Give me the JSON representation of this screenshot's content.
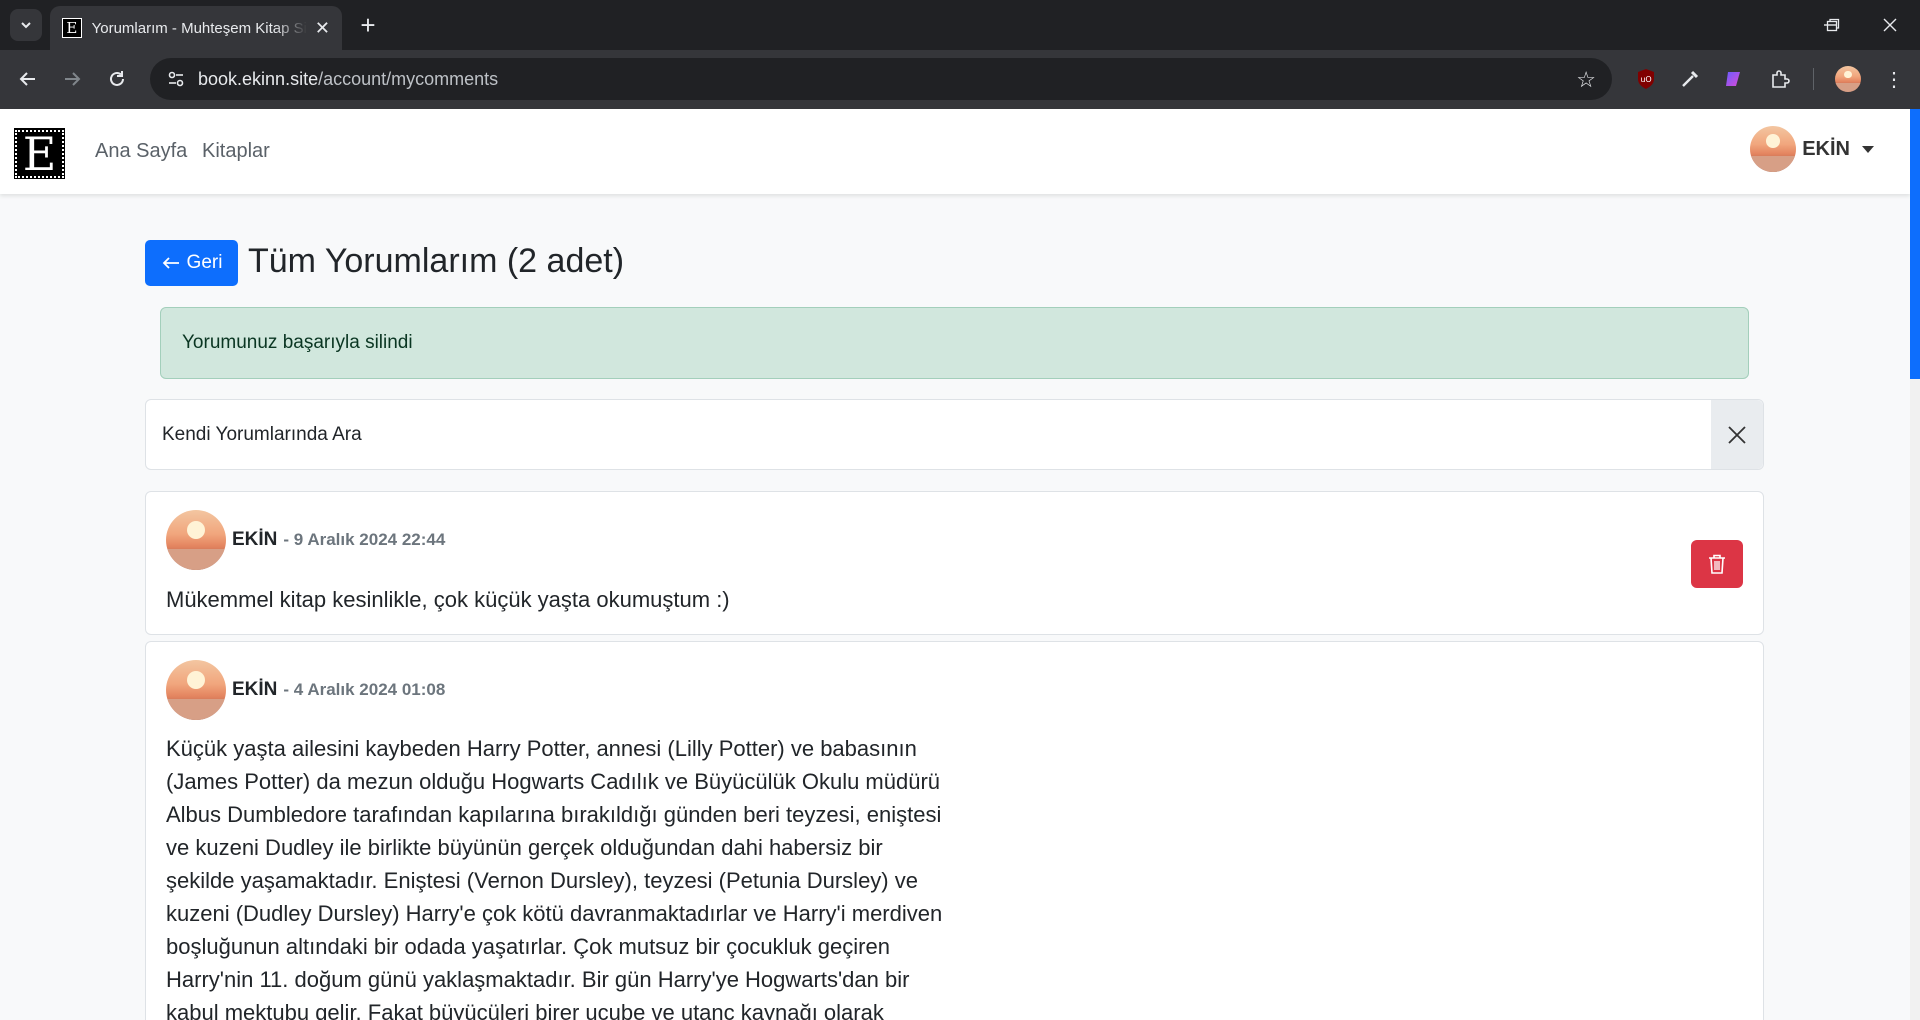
{
  "browser": {
    "tab_title": "Yorumlarım - Muhteşem Kitap Sitesi",
    "tab_favicon_letter": "E",
    "url_domain": "book.ekinn.site",
    "url_path": "/account/mycomments"
  },
  "navbar": {
    "brand_letter": "E",
    "links": [
      "Ana Sayfa",
      "Kitaplar"
    ],
    "user_name": "EKİN"
  },
  "header": {
    "back_label": "Geri",
    "title": "Tüm Yorumlarım (2 adet)"
  },
  "alert": {
    "message": "Yorumunuz başarıyla silindi",
    "color": "#d1e7dd"
  },
  "search": {
    "placeholder": "Kendi Yorumlarında Ara"
  },
  "comments": [
    {
      "author": "EKİN",
      "date": "- 9 Aralık 2024 22:44",
      "text": "Mükemmel kitap kesinlikle, çok küçük yaşta okumuştum :)"
    },
    {
      "author": "EKİN",
      "date": "- 4 Aralık 2024 01:08",
      "text_lines": [
        "Küçük yaşta ailesini kaybeden Harry Potter, annesi (Lilly Potter) ve babasının",
        "(James Potter) da mezun olduğu Hogwarts Cadılık ve Büyücülük Okulu müdürü",
        "Albus Dumbledore tarafından kapılarına bırakıldığı günden beri teyzesi, eniştesi",
        "ve kuzeni Dudley ile birlikte büyünün gerçek olduğundan dahi habersiz bir",
        "şekilde yaşamaktadır. Eniştesi (Vernon Dursley), teyzesi (Petunia Dursley) ve",
        "kuzeni (Dudley Dursley) Harry'e çok kötü davranmaktadırlar ve Harry'i merdiven",
        "boşluğunun altındaki bir odada yaşatırlar. Çok mutsuz bir çocukluk geçiren",
        "Harry'nin 11. doğum günü yaklaşmaktadır. Bir gün Harry'ye Hogwarts'dan bir",
        "kabul mektubu gelir. Fakat büyücüleri birer ucube ve utanç kaynağı olarak"
      ]
    }
  ],
  "colors": {
    "primary": "#0d6efd",
    "danger": "#dc3545"
  }
}
